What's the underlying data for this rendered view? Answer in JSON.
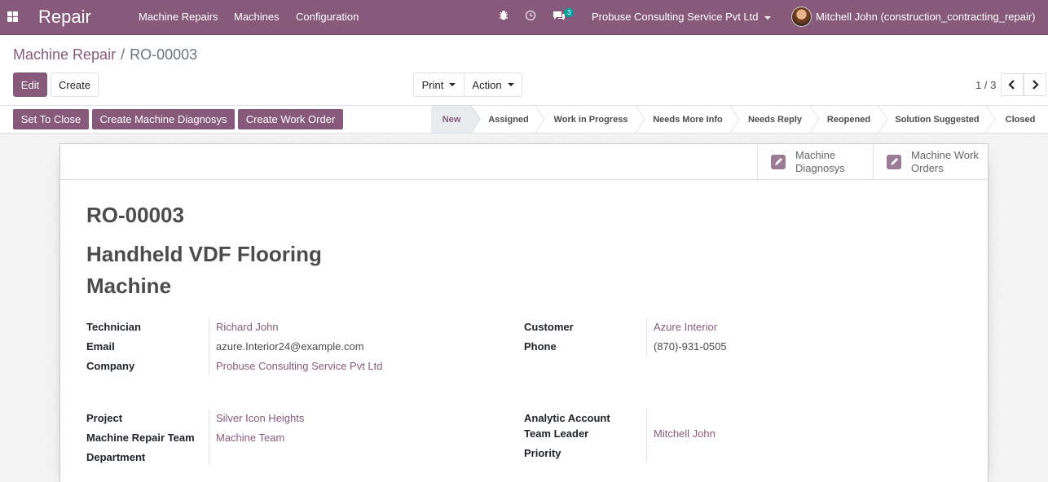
{
  "navbar": {
    "brand": "Repair",
    "menus": [
      "Machine Repairs",
      "Machines",
      "Configuration"
    ],
    "chat_count": "3",
    "company": "Probuse Consulting Service Pvt Ltd",
    "user": "Mitchell John (construction_contracting_repair)"
  },
  "breadcrumb": {
    "parent": "Machine Repair",
    "separator": "/",
    "current": "RO-00003"
  },
  "buttons": {
    "edit": "Edit",
    "create": "Create",
    "print": "Print",
    "action": "Action"
  },
  "pager": {
    "text": "1 / 3"
  },
  "header_buttons": {
    "set_to_close": "Set To Close",
    "diagnosys": "Create Machine Diagnosys",
    "work_order": "Create Work Order"
  },
  "stages": [
    "New",
    "Assigned",
    "Work in Progress",
    "Needs More Info",
    "Needs Reply",
    "Reopened",
    "Solution Suggested",
    "Closed"
  ],
  "active_stage": "New",
  "smart_buttons": {
    "diagnosys_1": "Machine",
    "diagnosys_2": "Diagnosys",
    "orders_1": "Machine Work",
    "orders_2": "Orders"
  },
  "record": {
    "ref": "RO-00003",
    "title": "Handheld VDF Flooring Machine"
  },
  "fields": {
    "technician_label": "Technician",
    "technician": "Richard John",
    "email_label": "Email",
    "email": "azure.Interior24@example.com",
    "company_label": "Company",
    "company": "Probuse Consulting Service Pvt Ltd",
    "customer_label": "Customer",
    "customer": "Azure Interior",
    "phone_label": "Phone",
    "phone": "(870)-931-0505",
    "project_label": "Project",
    "project": "Silver Icon Heights",
    "team_label": "Machine Repair Team",
    "team": "Machine Team",
    "department_label": "Department",
    "analytic_label": "Analytic Account",
    "leader_label": "Team Leader",
    "leader": "Mitchell John",
    "priority_label": "Priority"
  },
  "colors": {
    "primary": "#875a7b",
    "badge": "#00a09d"
  }
}
